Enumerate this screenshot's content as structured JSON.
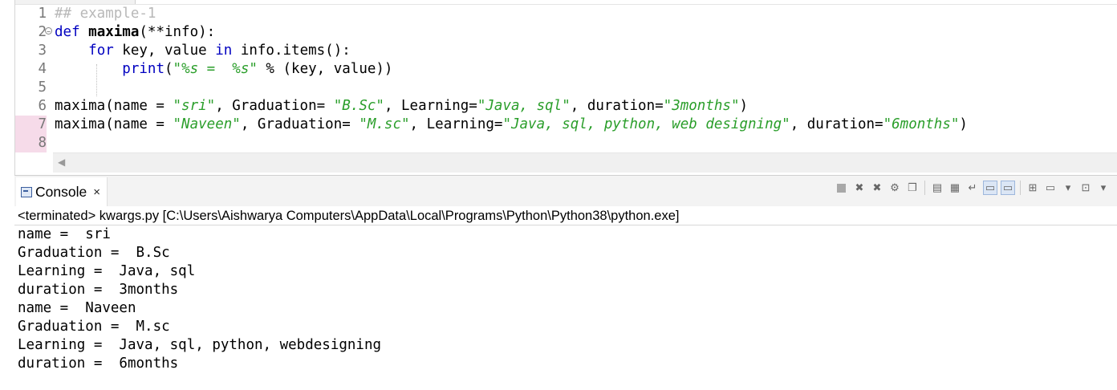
{
  "editor": {
    "lines": [
      {
        "num": "1",
        "segments": [
          {
            "t": "## example-1",
            "c": "cmt"
          }
        ]
      },
      {
        "num": "2",
        "fold": "⊖",
        "segments": [
          {
            "t": "def",
            "c": "kw"
          },
          {
            "t": " ",
            "c": ""
          },
          {
            "t": "maxima",
            "c": "fn"
          },
          {
            "t": "(**info):",
            "c": ""
          }
        ]
      },
      {
        "num": "3",
        "segments": [
          {
            "t": "    ",
            "c": ""
          },
          {
            "t": "for",
            "c": "kw"
          },
          {
            "t": " key, value ",
            "c": ""
          },
          {
            "t": "in",
            "c": "kw"
          },
          {
            "t": " info.items():",
            "c": ""
          }
        ]
      },
      {
        "num": "4",
        "segments": [
          {
            "t": "        ",
            "c": ""
          },
          {
            "t": "print",
            "c": "kw"
          },
          {
            "t": "(",
            "c": ""
          },
          {
            "t": "\"%s =  %s\"",
            "c": "str"
          },
          {
            "t": " % (key, value))",
            "c": ""
          }
        ]
      },
      {
        "num": "5",
        "segments": []
      },
      {
        "num": "6",
        "segments": [
          {
            "t": "maxima(name = ",
            "c": ""
          },
          {
            "t": "\"sri\"",
            "c": "str"
          },
          {
            "t": ", Graduation= ",
            "c": ""
          },
          {
            "t": "\"B.Sc\"",
            "c": "str"
          },
          {
            "t": ", Learning=",
            "c": ""
          },
          {
            "t": "\"Java, sql\"",
            "c": "str"
          },
          {
            "t": ", duration=",
            "c": ""
          },
          {
            "t": "\"3months\"",
            "c": "str"
          },
          {
            "t": ")",
            "c": ""
          }
        ]
      },
      {
        "num": "7",
        "modified": true,
        "segments": [
          {
            "t": "maxima(name = ",
            "c": ""
          },
          {
            "t": "\"Naveen\"",
            "c": "str"
          },
          {
            "t": ", Graduation= ",
            "c": ""
          },
          {
            "t": "\"M.sc\"",
            "c": "str"
          },
          {
            "t": ", Learning=",
            "c": ""
          },
          {
            "t": "\"Java, sql, python, web designing\"",
            "c": "str"
          },
          {
            "t": ", duration=",
            "c": ""
          },
          {
            "t": "\"6months\"",
            "c": "str"
          },
          {
            "t": ")",
            "c": ""
          }
        ]
      },
      {
        "num": "8",
        "modified": true,
        "segments": []
      }
    ]
  },
  "console": {
    "tab_label": "Console",
    "close_label": "×",
    "status": "<terminated> kwargs.py [C:\\Users\\Aishwarya Computers\\AppData\\Local\\Programs\\Python\\Python38\\python.exe]",
    "output": [
      "name =  sri",
      "Graduation =  B.Sc",
      "Learning =  Java, sql",
      "duration =  3months",
      "name =  Naveen",
      "Graduation =  M.sc",
      "Learning =  Java, sql, python, webdesigning",
      "duration =  6months"
    ],
    "toolbar_icons": [
      "terminate-icon",
      "remove-launch-icon",
      "remove-all-terminated-icon",
      "debug-launch-icon",
      "copy-icon",
      "clear-console-icon",
      "scroll-lock-icon",
      "word-wrap-icon",
      "show-stdout-icon",
      "show-stderr-icon",
      "pin-console-icon",
      "display-selected-console-icon",
      "display-menu-icon",
      "open-console-icon",
      "open-console-menu-icon"
    ]
  }
}
